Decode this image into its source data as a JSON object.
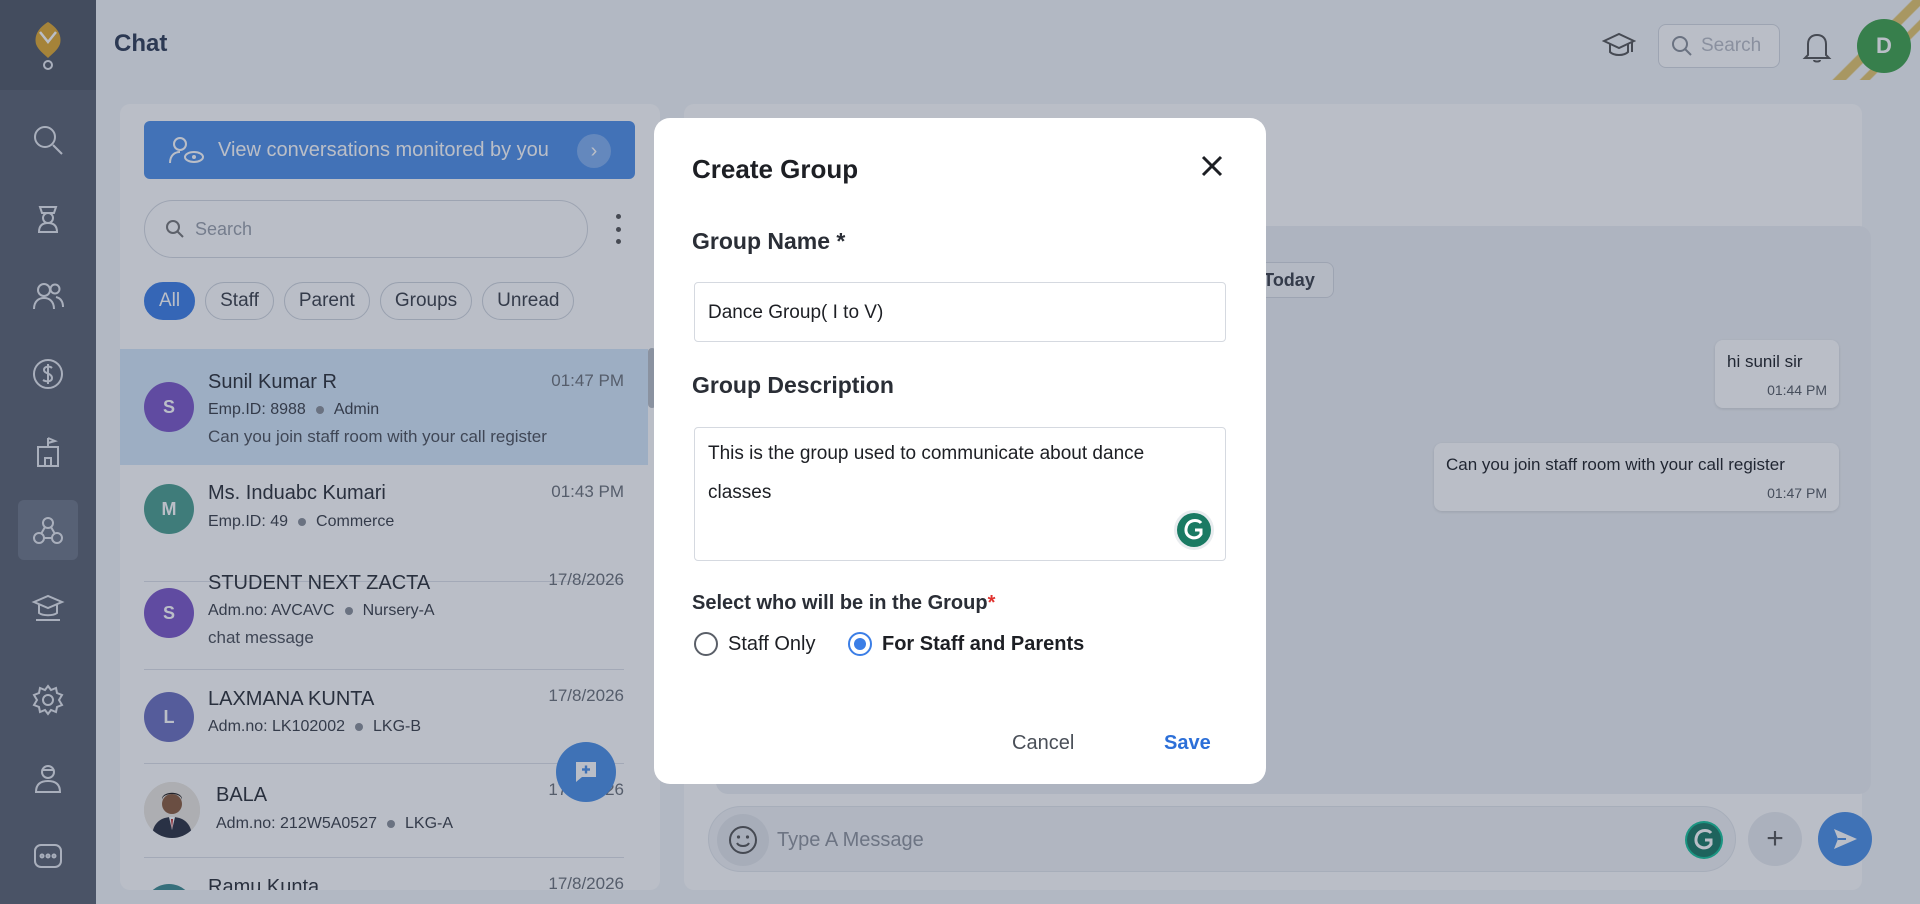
{
  "header": {
    "title": "Chat",
    "search_placeholder": "Search",
    "avatar_initial": "D"
  },
  "rail": {
    "items": [
      {
        "icon": "search-icon"
      },
      {
        "icon": "student-icon"
      },
      {
        "icon": "users-icon"
      },
      {
        "icon": "dollar-icon"
      },
      {
        "icon": "building-icon"
      },
      {
        "icon": "chat-network-icon",
        "active": true
      },
      {
        "icon": "school-icon"
      },
      {
        "icon": "gear-icon"
      },
      {
        "icon": "teacher-icon"
      },
      {
        "icon": "more-icon"
      }
    ]
  },
  "list": {
    "monitor_banner": "View conversations monitored by you",
    "search_placeholder": "Search",
    "filters": [
      "All",
      "Staff",
      "Parent",
      "Groups",
      "Unread"
    ],
    "active_filter": "All",
    "chats": [
      {
        "initial": "S",
        "avatar_color": "#7b56c8",
        "name": "Sunil Kumar R",
        "id": "Emp.ID: 8988",
        "tag": "Admin",
        "preview": "Can you join staff room with your call register",
        "time": "01:47 PM"
      },
      {
        "initial": "M",
        "avatar_color": "#4a9e8e",
        "name": "Ms. Induabc Kumari",
        "id": "Emp.ID: 49",
        "tag": "Commerce",
        "preview": "",
        "time": "01:43 PM"
      },
      {
        "initial": "S",
        "avatar_color": "#7b56c8",
        "name": "STUDENT NEXT ZACTA",
        "id": "Adm.no: AVCAVC",
        "tag": "Nursery-A",
        "preview": "chat message",
        "time": "17/8/2026"
      },
      {
        "initial": "L",
        "avatar_color": "#6a6fbf",
        "name": "LAXMANA KUNTA",
        "id": "Adm.no: LK102002",
        "tag": "LKG-B",
        "preview": "",
        "time": "17/8/2026"
      },
      {
        "initial": "",
        "avatar_color": "",
        "name": "BALA",
        "id": "Adm.no: 212W5A0527",
        "tag": "LKG-A",
        "preview": "",
        "time": "17/8/2026"
      },
      {
        "initial": "",
        "avatar_color": "#3d8b8f",
        "name": "Ramu Kunta",
        "id": "",
        "tag": "",
        "preview": "",
        "time": "17/8/2026"
      }
    ]
  },
  "conversation": {
    "date_label": "Today",
    "messages": [
      {
        "text": "hi sunil sir",
        "time": "01:44 PM"
      },
      {
        "text": "Can you join staff room with your call register",
        "time": "01:47 PM"
      }
    ],
    "composer_placeholder": "Type A Message"
  },
  "dialog": {
    "title": "Create Group",
    "group_name_label": "Group Name *",
    "group_name_value": "Dance Group( I to V)",
    "group_desc_label": "Group Description",
    "group_desc_value": "This is the group used to communicate about dance classes",
    "members_label": "Select who will be in the Group",
    "members_required": "*",
    "options": [
      {
        "label": "Staff Only",
        "selected": false
      },
      {
        "label": "For Staff and Parents",
        "selected": true
      }
    ],
    "cancel_label": "Cancel",
    "save_label": "Save"
  },
  "colors": {
    "accent": "#3b7ee6",
    "overlay": "#283450",
    "required": "#e0322f"
  }
}
